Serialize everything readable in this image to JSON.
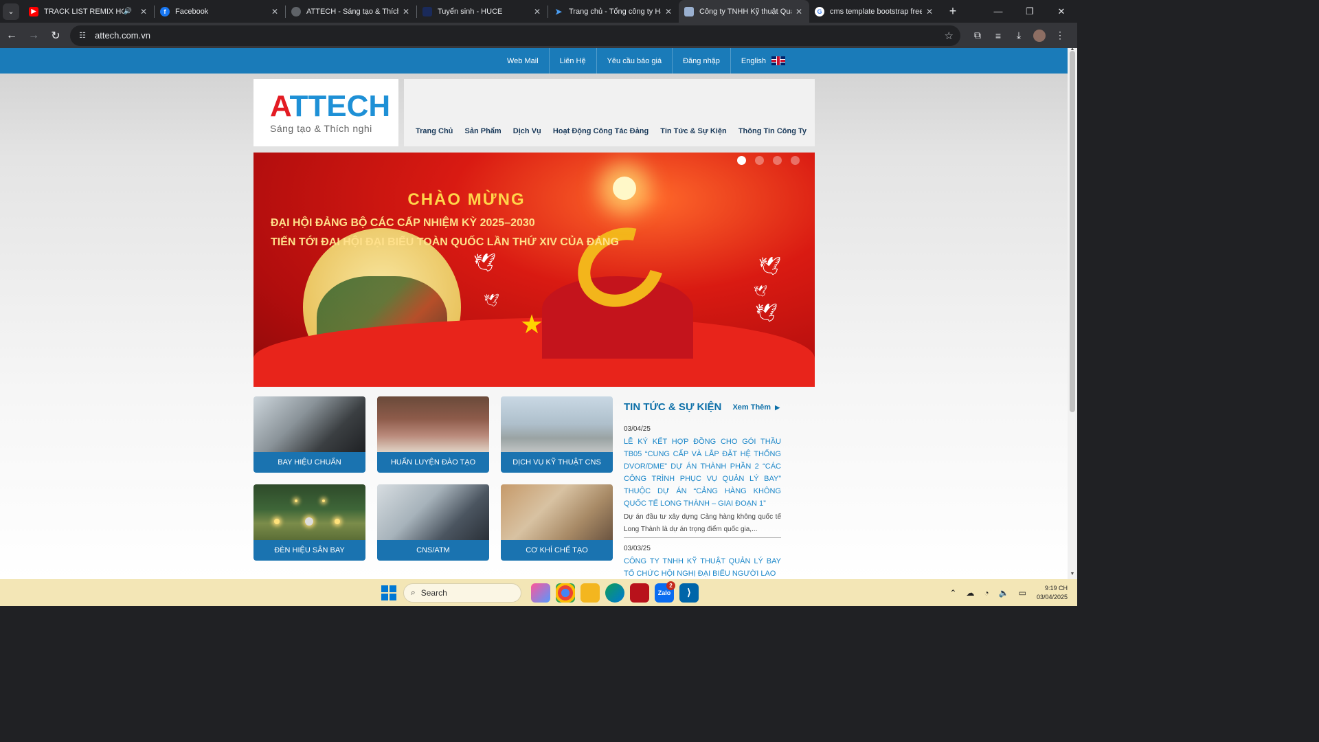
{
  "browser": {
    "tabs": [
      {
        "title": "TRACK LIST REMIX HOT TIK",
        "favicon": "youtube-icon",
        "color": "#ff0000",
        "audio": true
      },
      {
        "title": "Facebook",
        "favicon": "facebook-icon",
        "color": "#1877f2"
      },
      {
        "title": "ATTECH - Sáng tạo & Thích ngh",
        "favicon": "globe-icon",
        "color": "#5f6368"
      },
      {
        "title": "Tuyển sinh - HUCE",
        "favicon": "huce-icon",
        "color": "#1a2a5a"
      },
      {
        "title": "Trang chủ - Tổng công ty Hàng",
        "favicon": "plane-icon",
        "color": "#1a73e8"
      },
      {
        "title": "Công ty TNHH Kỹ thuật Quản lý",
        "favicon": "page-icon",
        "color": "#9ab0d0",
        "active": true
      },
      {
        "title": "cms template bootstrap free -",
        "favicon": "google-icon",
        "color": "#4285f4"
      }
    ],
    "url": "attech.com.vn"
  },
  "topbar": {
    "links": [
      "Web Mail",
      "Liên Hệ",
      "Yêu cầu báo giá",
      "Đăng nhập",
      "English"
    ]
  },
  "logo": {
    "first_letter": "A",
    "rest": "TTECH",
    "slogan": "Sáng tạo & Thích nghi"
  },
  "mainnav": {
    "items": [
      "Trang Chủ",
      "Sản Phẩm",
      "Dịch Vụ",
      "Hoạt Động Công Tác Đảng",
      "Tin Tức & Sự Kiện",
      "Thông Tin Công Ty"
    ]
  },
  "banner": {
    "line1": "CHÀO MỪNG",
    "line2": "ĐẠI HỘI ĐẢNG BỘ CÁC CẤP NHIỆM KỲ 2025–2030",
    "line3": "TIẾN TỚI ĐẠI HỘI ĐẠI BIỂU TOÀN QUỐC LẦN THỨ XIV CỦA ĐẢNG",
    "slides": 4,
    "active_slide": 1
  },
  "tiles": [
    {
      "label": "BAY HIỆU CHUẨN"
    },
    {
      "label": "HUẤN LUYỆN ĐÀO TẠO"
    },
    {
      "label": "DỊCH VỤ KỸ THUẬT CNS"
    },
    {
      "label": "ĐÈN HIỆU SÂN BAY"
    },
    {
      "label": "CNS/ATM"
    },
    {
      "label": "CƠ KHÍ CHẾ TẠO"
    }
  ],
  "news": {
    "title": "TIN TỨC & SỰ KIỆN",
    "more": "Xem Thêm",
    "items": [
      {
        "date": "03/04/25",
        "headline": "LỄ KÝ KẾT HỢP ĐỒNG CHO GÓI THẦU TB05 “CUNG CẤP VÀ LẮP ĐẶT HỆ THỐNG DVOR/DME” DỰ ÁN THÀNH PHẦN 2 “CÁC CÔNG TRÌNH PHỤC VỤ QUẢN LÝ BAY” THUỘC DỰ ÁN “CẢNG HÀNG KHÔNG QUỐC TẾ LONG THÀNH – GIAI ĐOẠN 1”",
        "desc": "Dự án đầu tư xây dựng Cảng hàng không quốc tế Long Thành là dự án trọng điểm quốc gia,..."
      },
      {
        "date": "03/03/25",
        "headline": "CÔNG TY TNHH KỸ THUẬT QUẢN LÝ BAY TỔ CHỨC HỘI NGHỊ ĐẠI BIỂU NGƯỜI LAO"
      }
    ]
  },
  "taskbar": {
    "search_placeholder": "Search",
    "zalo_badge": "2",
    "time": "9:19 CH",
    "date": "03/04/2025"
  }
}
